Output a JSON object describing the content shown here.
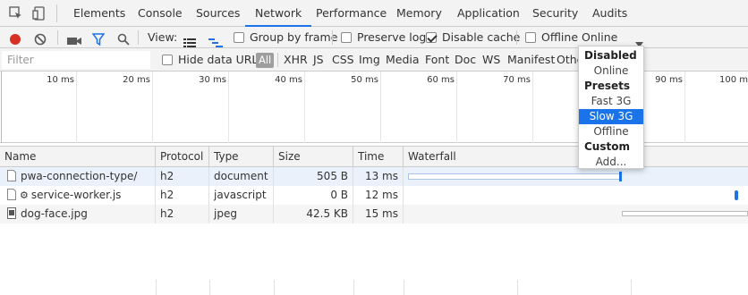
{
  "tabs": [
    "Elements",
    "Console",
    "Sources",
    "Network",
    "Performance",
    "Memory",
    "Application",
    "Security",
    "Audits"
  ],
  "active_tab": "Network",
  "toolbar": {
    "view_label": "View:",
    "group_by_frame": "Group by frame",
    "preserve_log": "Preserve log",
    "disable_cache": "Disable cache",
    "offline": "Offline",
    "throttle_value": "Online"
  },
  "filterbar": {
    "placeholder": "Filter",
    "hide_data_urls": "Hide data URLs",
    "types": [
      "All",
      "XHR",
      "JS",
      "CSS",
      "Img",
      "Media",
      "Font",
      "Doc",
      "WS",
      "Manifest",
      "Othe"
    ]
  },
  "overview_ticks": [
    "10 ms",
    "20 ms",
    "30 ms",
    "40 ms",
    "50 ms",
    "60 ms",
    "70 ms",
    "80 ms",
    "90 ms",
    "100 m"
  ],
  "columns": [
    "Name",
    "Protocol",
    "Type",
    "Size",
    "Time",
    "Waterfall"
  ],
  "rows": [
    {
      "name": "pwa-connection-type/",
      "protocol": "h2",
      "type": "document",
      "size": "505 B",
      "time": "13 ms"
    },
    {
      "name": "service-worker.js",
      "protocol": "h2",
      "type": "javascript",
      "size": "0 B",
      "time": "12 ms"
    },
    {
      "name": "dog-face.jpg",
      "protocol": "h2",
      "type": "jpeg",
      "size": "42.5 KB",
      "time": "15 ms"
    }
  ],
  "dropdown": {
    "disabled_group": "Disabled",
    "online": "Online",
    "presets_group": "Presets",
    "fast3g": "Fast 3G",
    "slow3g": "Slow 3G",
    "offline": "Offline",
    "custom_group": "Custom",
    "add": "Add..."
  },
  "colors": {
    "accent": "#1a73e8",
    "record": "#d93025",
    "waterfall_bar": "#1a73e8"
  }
}
